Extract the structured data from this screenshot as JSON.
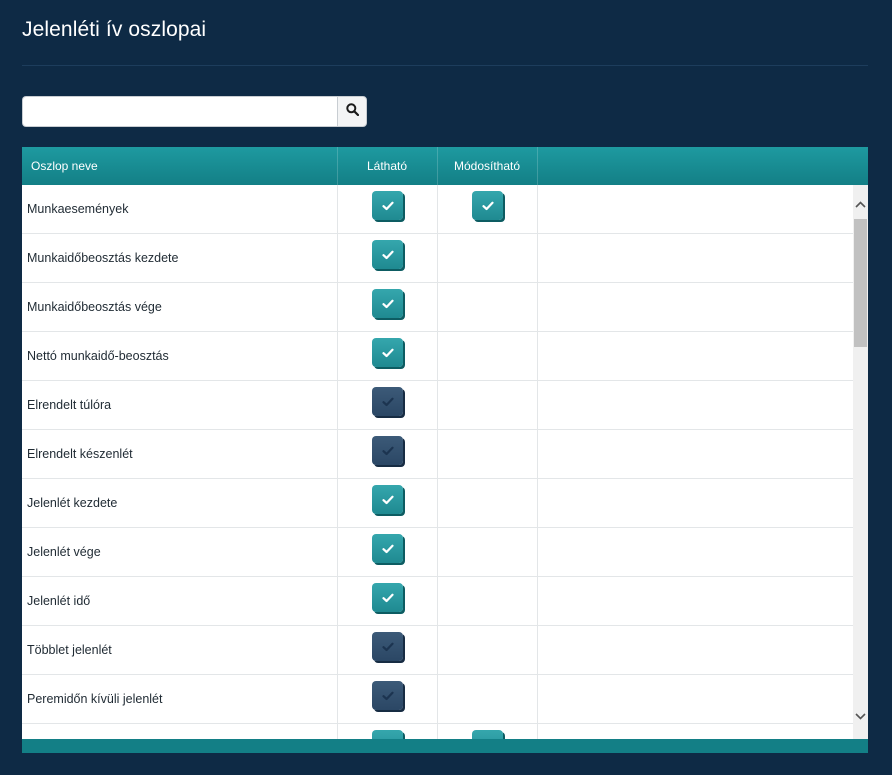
{
  "page": {
    "title": "Jelenléti ív oszlopai"
  },
  "search": {
    "value": "",
    "placeholder": ""
  },
  "grid": {
    "columns": {
      "name": "Oszlop neve",
      "visible": "Látható",
      "editable": "Módosítható"
    },
    "rows": [
      {
        "name": "Munkaesemények",
        "visible": true,
        "editable": true
      },
      {
        "name": "Munkaidőbeosztás kezdete",
        "visible": true,
        "editable": null
      },
      {
        "name": "Munkaidőbeosztás vége",
        "visible": true,
        "editable": null
      },
      {
        "name": "Nettó munkaidő-beosztás",
        "visible": true,
        "editable": null
      },
      {
        "name": "Elrendelt túlóra",
        "visible": false,
        "editable": null
      },
      {
        "name": "Elrendelt készenlét",
        "visible": false,
        "editable": null
      },
      {
        "name": "Jelenlét kezdete",
        "visible": true,
        "editable": null
      },
      {
        "name": "Jelenlét vége",
        "visible": true,
        "editable": null
      },
      {
        "name": "Jelenlét idő",
        "visible": true,
        "editable": null
      },
      {
        "name": "Többlet jelenlét",
        "visible": false,
        "editable": null
      },
      {
        "name": "Peremidőn kívüli jelenlét",
        "visible": false,
        "editable": null
      },
      {
        "name": "",
        "visible": true,
        "editable": true
      }
    ]
  },
  "colors": {
    "background": "#0e2a45",
    "header": "#1a8f96",
    "checked": "#2a9aa0",
    "unchecked": "#34506e"
  },
  "icons": {
    "search": "search-icon",
    "check": "check-icon",
    "scroll_up": "chevron-up-icon",
    "scroll_down": "chevron-down-icon"
  }
}
